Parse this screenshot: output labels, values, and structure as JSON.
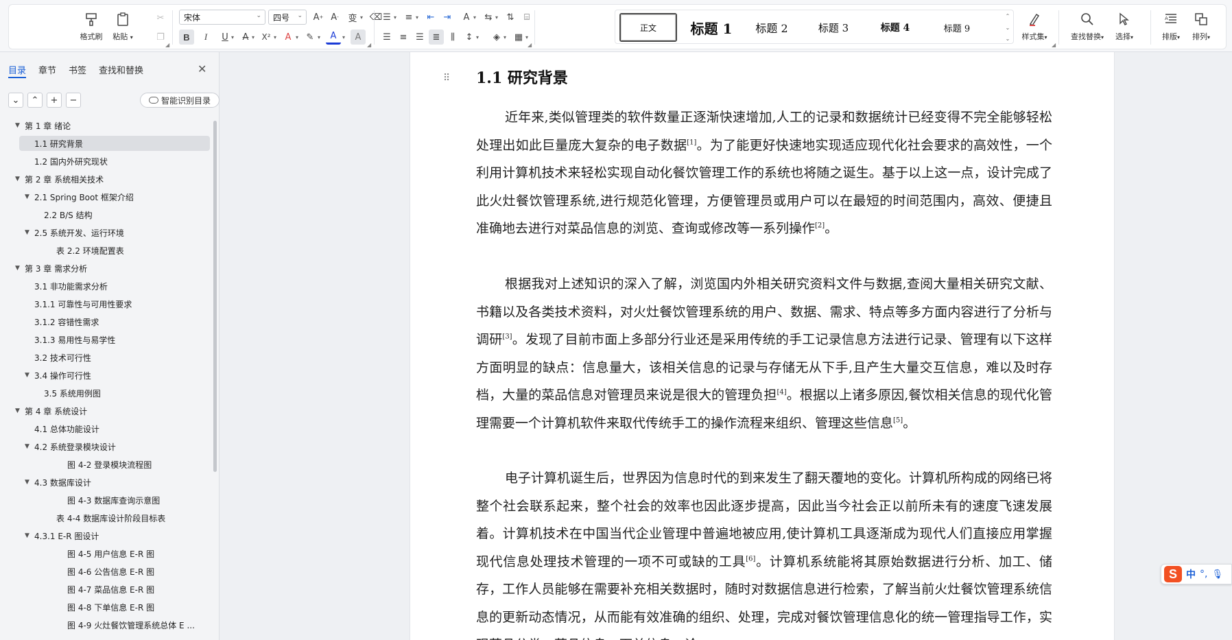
{
  "ribbon": {
    "clipboard": {
      "format_painter": "格式刷",
      "paste": "粘贴"
    },
    "font": {
      "name": "宋体",
      "size": "四号",
      "bold": "B",
      "italic": "I",
      "underline": "U",
      "strike": "A",
      "superscript": "X²",
      "font_color_letter": "A",
      "highlight_letter": "A",
      "char_shading": "A"
    },
    "styles": {
      "items": [
        "正文",
        "标题 1",
        "标题 2",
        "标题 3",
        "标题 4",
        "标题 9"
      ],
      "selected": "正文",
      "set_label": "样式集"
    },
    "find_replace": "查找替换",
    "select": "选择",
    "layout": "排版",
    "arrange": "排列"
  },
  "nav": {
    "tabs": [
      "目录",
      "章节",
      "书签",
      "查找和替换"
    ],
    "active_tab": "目录",
    "smart_toc": "智能识别目录",
    "toc": [
      {
        "text": "第 1 章   绪论",
        "level": 0,
        "expandable": true
      },
      {
        "text": "1.1   研究背景",
        "level": 1,
        "selected": true
      },
      {
        "text": "1.2   国内外研究现状",
        "level": 1
      },
      {
        "text": "第 2 章   系统相关技术",
        "level": 0,
        "expandable": true
      },
      {
        "text": "2.1 Spring Boot 框架介绍",
        "level": 1,
        "expandable": true
      },
      {
        "text": "2.2   B/S 结构",
        "level": 2
      },
      {
        "text": "2.5   系统开发、运行环境",
        "level": 1,
        "expandable": true
      },
      {
        "text": "表 2.2   环境配置表",
        "level": 3
      },
      {
        "text": "第 3 章   需求分析",
        "level": 0,
        "expandable": true
      },
      {
        "text": "3.1   非功能需求分析",
        "level": 1
      },
      {
        "text": "3.1.1   可靠性与可用性要求",
        "level": 1
      },
      {
        "text": "3.1.2   容错性需求",
        "level": 1
      },
      {
        "text": "3.1.3   易用性与易学性",
        "level": 1
      },
      {
        "text": "3.2   技术可行性",
        "level": 1
      },
      {
        "text": "3.4   操作可行性",
        "level": 1,
        "expandable": true
      },
      {
        "text": "3.5 系统用例图",
        "level": 2
      },
      {
        "text": "第 4 章   系统设计",
        "level": 0,
        "expandable": true
      },
      {
        "text": "4.1   总体功能设计",
        "level": 1
      },
      {
        "text": "4.2   系统登录模块设计",
        "level": 1,
        "expandable": true
      },
      {
        "text": "图 4-2   登录模块流程图",
        "level": 4
      },
      {
        "text": "4.3   数据库设计",
        "level": 1,
        "expandable": true
      },
      {
        "text": "图 4-3   数据库查询示意图",
        "level": 4
      },
      {
        "text": "表 4-4   数据库设计阶段目标表",
        "level": 3
      },
      {
        "text": "4.3.1   E-R 图设计",
        "level": 1,
        "expandable": true
      },
      {
        "text": "图 4-5 用户信息 E-R 图",
        "level": 4
      },
      {
        "text": "图 4-6 公告信息 E-R 图",
        "level": 4
      },
      {
        "text": "图 4-7 菜品信息 E-R 图",
        "level": 4
      },
      {
        "text": "图 4-8 下单信息 E-R 图",
        "level": 4
      },
      {
        "text": "图 4-9 火灶餐饮管理系统总体 E ...",
        "level": 4
      }
    ]
  },
  "document": {
    "heading": "1.1   研究背景",
    "paragraphs": [
      [
        {
          "t": "近年来,类似管理类的软件数量正逐渐快速增加,人工的记录和数据统计已经变得不完全能够轻松处理出如此巨量庞大复杂的电子数据"
        },
        {
          "sup": "[1]"
        },
        {
          "t": "。为了能更好快速地实现适应现代化社会要求的高效性，一个利用计算机技术来轻松实现自动化餐饮管理工作的系统也将随之诞生。基于以上这一点，设计完成了此火灶餐饮管理系统,进行规范化管理，方便管理员或用户可以在最短的时间范围内，高效、便捷且准确地去进行对菜品信息的浏览、查询或修改等一系列操作"
        },
        {
          "sup": "[2]"
        },
        {
          "t": "。"
        }
      ],
      [
        {
          "t": "根据我对上述知识的深入了解，浏览国内外相关研究资料文件与数据,查阅大量相关研究文献、书籍以及各类技术资料，对火灶餐饮管理系统的用户、数据、需求、特点等多方面内容进行了分析与调研"
        },
        {
          "sup": "[3]"
        },
        {
          "t": "。发现了目前市面上多部分行业还是采用传统的手工记录信息方法进行记录、管理有以下这样方面明显的缺点：信息量大，该相关信息的记录与存储无从下手,且产生大量交互信息，难以及时存档，大量的菜品信息对管理员来说是很大的管理负担"
        },
        {
          "sup": "[4]"
        },
        {
          "t": "。根据以上诸多原因,餐饮相关信息的现代化管理需要一个计算机软件来取代传统手工的操作流程来组织、管理这些信息"
        },
        {
          "sup": "[5]"
        },
        {
          "t": "。"
        }
      ],
      [
        {
          "t": "电子计算机诞生后，世界因为信息时代的到来发生了翻天覆地的变化。计算机所构成的网络已将整个社会联系起来，整个社会的效率也因此逐步提高，因此当今社会正以前所未有的速度飞速发展着。计算机技术在中国当代企业管理中普遍地被应用,使计算机工具逐渐成为现代人们直接应用掌握现代信息处理技术管理的一项不可或缺的工具"
        },
        {
          "sup": "[6]"
        },
        {
          "t": "。计算机系统能将其原始数据进行分析、加工、储存，工作人员能够在需要补充相关数据时，随时对数据信息进行检索，了解当前火灶餐饮管理系统信息的更新动态情况，从而能有效准确的组织、处理，完成对餐饮管理信息化的统一管理指导工作，实现菜品分类、菜品信息、下单信息、论"
        }
      ]
    ]
  },
  "ime": {
    "logo": "S",
    "mode": "中",
    "punct": "°,"
  }
}
